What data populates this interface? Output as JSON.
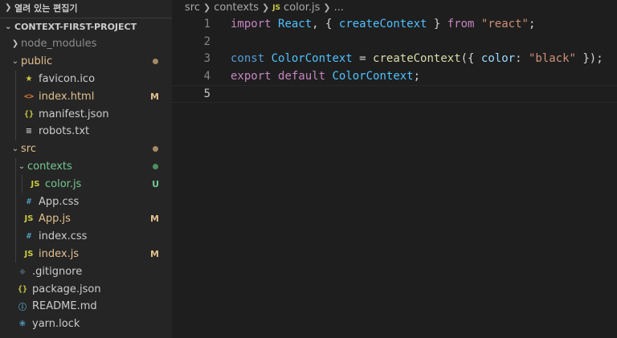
{
  "sidebar": {
    "open_editors_label": "열려 있는 편집기",
    "project_label": "CONTEXT-FIRST-PROJECT",
    "items": [
      {
        "label": "node_modules",
        "icon": "chevron-right",
        "depth": 0,
        "folder": true,
        "open": false,
        "color": "#8c8c8c"
      },
      {
        "label": "public",
        "depth": 0,
        "folder": true,
        "open": true,
        "color": "#e2c08d",
        "dot": "#a68a64"
      },
      {
        "label": "favicon.ico",
        "icon": "star-icon",
        "depth": 1,
        "color": "#cccccc"
      },
      {
        "label": "index.html",
        "icon": "html-icon",
        "depth": 1,
        "color": "#e2c08d",
        "badge": "M"
      },
      {
        "label": "manifest.json",
        "icon": "json-icon",
        "depth": 1,
        "color": "#cccccc"
      },
      {
        "label": "robots.txt",
        "icon": "lines-icon",
        "depth": 1,
        "color": "#cccccc"
      },
      {
        "label": "src",
        "depth": 0,
        "folder": true,
        "open": true,
        "color": "#e2c08d",
        "dot": "#a68a64"
      },
      {
        "label": "contexts",
        "depth": 1,
        "folder": true,
        "open": true,
        "color": "#73c991",
        "dot": "#4e8f5f"
      },
      {
        "label": "color.js",
        "icon": "js-icon",
        "depth": 2,
        "color": "#73c991",
        "badge": "U"
      },
      {
        "label": "App.css",
        "icon": "css-icon",
        "depth": 1,
        "color": "#cccccc"
      },
      {
        "label": "App.js",
        "icon": "js-icon",
        "depth": 1,
        "color": "#e2c08d",
        "badge": "M"
      },
      {
        "label": "index.css",
        "icon": "css-icon",
        "depth": 1,
        "color": "#cccccc"
      },
      {
        "label": "index.js",
        "icon": "js-icon",
        "depth": 1,
        "color": "#e2c08d",
        "badge": "M"
      },
      {
        "label": ".gitignore",
        "icon": "git-icon",
        "depth": 0,
        "color": "#cccccc"
      },
      {
        "label": "package.json",
        "icon": "json-icon",
        "depth": 0,
        "color": "#cccccc"
      },
      {
        "label": "README.md",
        "icon": "info-icon",
        "depth": 0,
        "color": "#cccccc"
      },
      {
        "label": "yarn.lock",
        "icon": "yarn-icon",
        "depth": 0,
        "color": "#cccccc"
      }
    ]
  },
  "editor": {
    "breadcrumb": {
      "seg1": "src",
      "seg2": "contexts",
      "file_icon": "JS",
      "seg3": "color.js",
      "seg4": "..."
    },
    "lines": [
      {
        "num": "1",
        "tokens": [
          [
            "import",
            "tk-kw"
          ],
          [
            " ",
            "tk-p"
          ],
          [
            "React",
            "tk-var"
          ],
          [
            ", { ",
            "tk-p"
          ],
          [
            "createContext",
            "tk-var"
          ],
          [
            " } ",
            "tk-p"
          ],
          [
            "from",
            "tk-kw"
          ],
          [
            " ",
            "tk-p"
          ],
          [
            "\"react\"",
            "tk-str"
          ],
          [
            ";",
            "tk-p"
          ]
        ]
      },
      {
        "num": "2",
        "tokens": []
      },
      {
        "num": "3",
        "tokens": [
          [
            "const",
            "tk-kw2"
          ],
          [
            " ",
            "tk-p"
          ],
          [
            "ColorContext",
            "tk-var"
          ],
          [
            " = ",
            "tk-p"
          ],
          [
            "createContext",
            "tk-fn"
          ],
          [
            "({ ",
            "tk-p"
          ],
          [
            "color",
            "tk-prop"
          ],
          [
            ": ",
            "tk-p"
          ],
          [
            "\"black\"",
            "tk-str"
          ],
          [
            " });",
            "tk-p"
          ]
        ]
      },
      {
        "num": "4",
        "tokens": [
          [
            "export",
            "tk-kw"
          ],
          [
            " ",
            "tk-p"
          ],
          [
            "default",
            "tk-kw"
          ],
          [
            " ",
            "tk-p"
          ],
          [
            "ColorContext",
            "tk-var"
          ],
          [
            ";",
            "tk-p"
          ]
        ]
      },
      {
        "num": "5",
        "tokens": [],
        "current": true
      }
    ]
  }
}
